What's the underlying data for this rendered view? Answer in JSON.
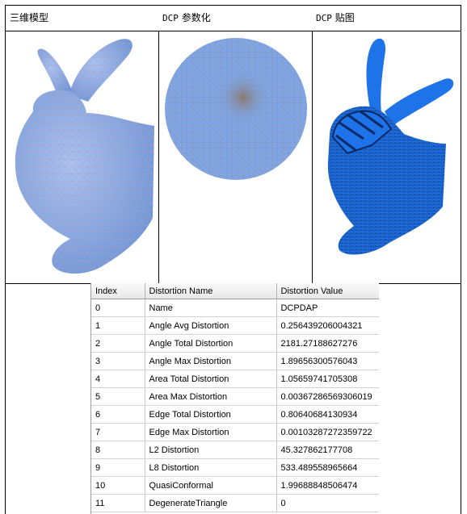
{
  "headers": [
    {
      "prefix": "",
      "text": "三维模型"
    },
    {
      "prefix": "DCP",
      "text": " 参数化"
    },
    {
      "prefix": "DCP",
      "text": " 贴图"
    }
  ],
  "figures": [
    {
      "icon": "bunny-mesh-3d-model"
    },
    {
      "icon": "dcp-parameterization-disk"
    },
    {
      "icon": "dcp-texture-mapped-bunny"
    }
  ],
  "colors": {
    "mesh_blue": "#7fa7e8",
    "texture_blue": "#1e73e8",
    "gridline": "#d2d2d2"
  },
  "table": {
    "columns": [
      "Index",
      "Distortion Name",
      "Distortion Value"
    ],
    "rows": [
      [
        "0",
        "Name",
        "DCPDAP"
      ],
      [
        "1",
        "Angle Avg Distortion",
        "0.256439206004321"
      ],
      [
        "2",
        "Angle Total Distortion",
        "2181.27188627276"
      ],
      [
        "3",
        "Angle Max Distortion",
        "1.89656300576043"
      ],
      [
        "4",
        "Area Total Distortion",
        "1.05659741705308"
      ],
      [
        "5",
        "Area Max Distortion",
        "0.00367286569306019"
      ],
      [
        "6",
        "Edge Total  Distortion",
        "0.80640684130934"
      ],
      [
        "7",
        "Edge Max  Distortion",
        "0.00103287272359722"
      ],
      [
        "8",
        "L2 Distortion",
        "45.327862177708"
      ],
      [
        "9",
        "L8 Distortion",
        "533.489558965664"
      ],
      [
        "10",
        "QuasiConformal",
        "1.99688848506474"
      ],
      [
        "11",
        "DegenerateTriangle",
        "0"
      ]
    ]
  }
}
